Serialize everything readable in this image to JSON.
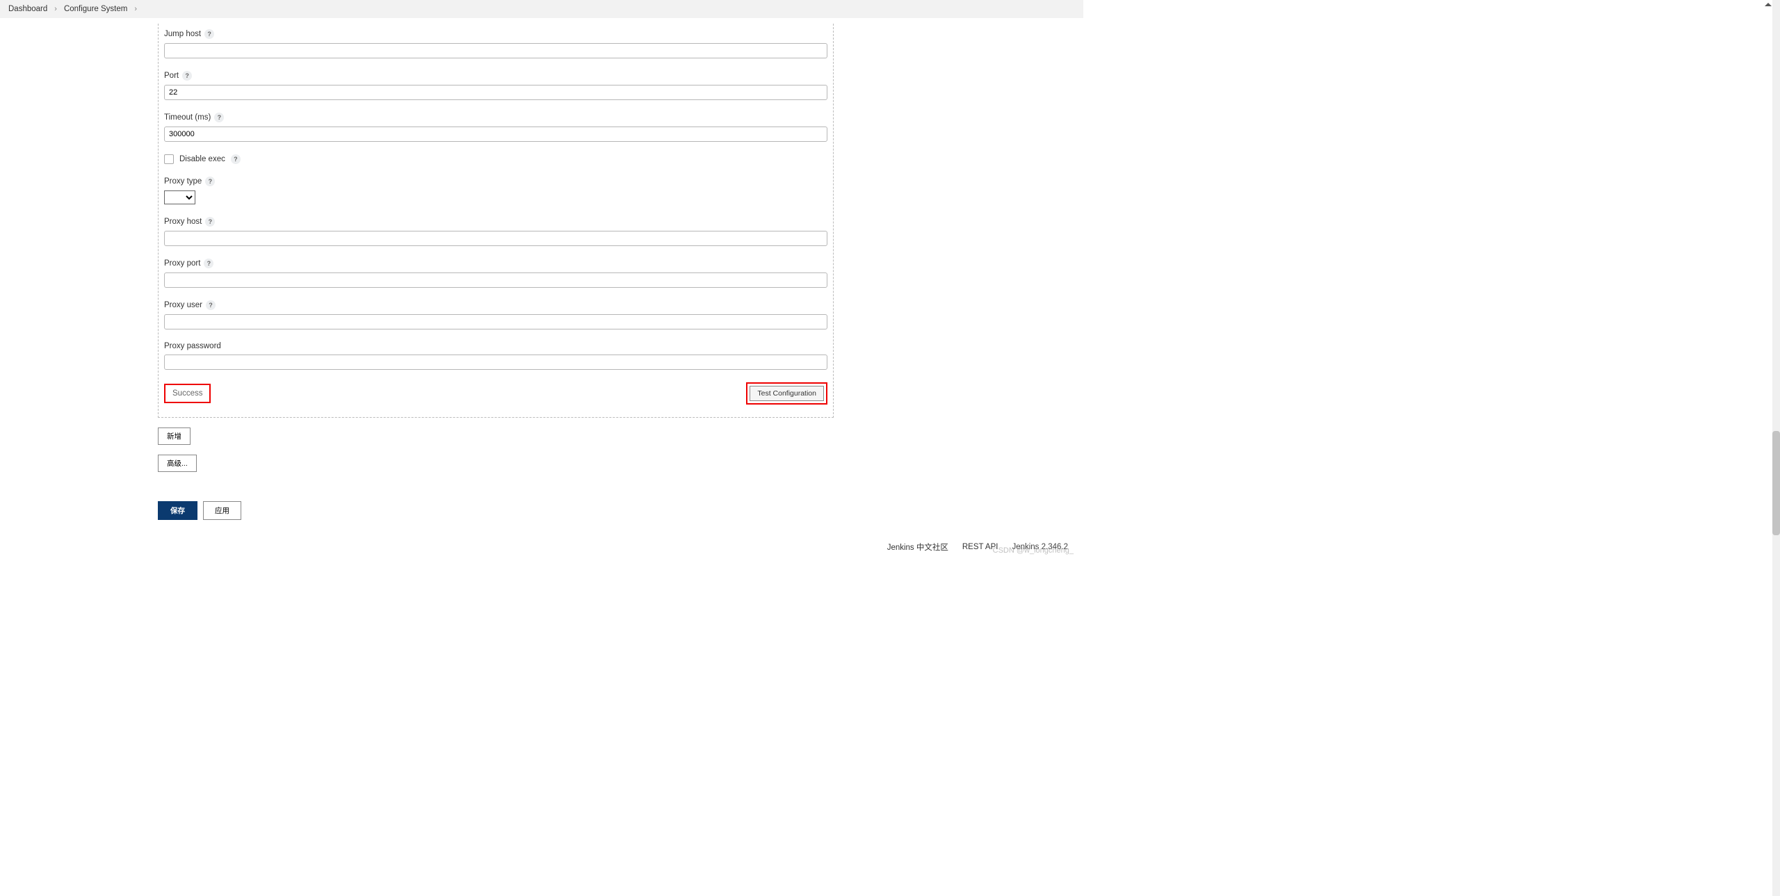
{
  "breadcrumb": {
    "items": [
      "Dashboard",
      "Configure System"
    ]
  },
  "form": {
    "jump_host": {
      "label": "Jump host",
      "value": ""
    },
    "port": {
      "label": "Port",
      "value": "22"
    },
    "timeout": {
      "label": "Timeout (ms)",
      "value": "300000"
    },
    "disable_exec": {
      "label": "Disable exec",
      "checked": false
    },
    "proxy_type": {
      "label": "Proxy type",
      "value": ""
    },
    "proxy_host": {
      "label": "Proxy host",
      "value": ""
    },
    "proxy_port": {
      "label": "Proxy port",
      "value": ""
    },
    "proxy_user": {
      "label": "Proxy user",
      "value": ""
    },
    "proxy_password": {
      "label": "Proxy password",
      "value": ""
    },
    "status_text": "Success",
    "test_button": "Test Configuration",
    "add_button": "新增",
    "advanced_button": "高级...",
    "save_button": "保存",
    "apply_button": "应用"
  },
  "footer": {
    "community": "Jenkins 中文社区",
    "rest_api": "REST API",
    "version": "Jenkins 2.346.2"
  },
  "watermark": "CSDN @w_longcheng_"
}
